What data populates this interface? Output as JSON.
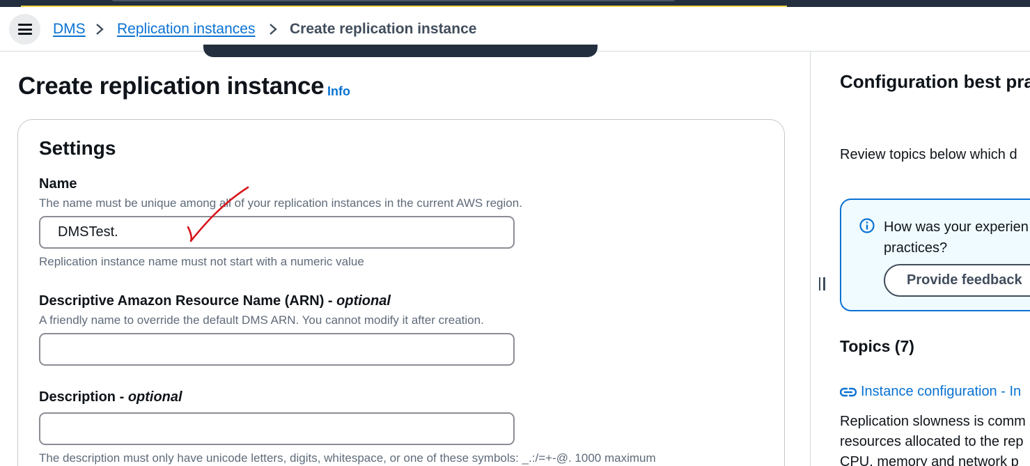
{
  "breadcrumb": {
    "items": [
      "DMS",
      "Replication instances",
      "Create replication instance"
    ]
  },
  "page": {
    "title": "Create replication instance",
    "info_label": "Info"
  },
  "settings": {
    "title": "Settings",
    "name": {
      "label": "Name",
      "description": "The name must be unique among all of your replication instances in the current AWS region.",
      "value": "DMSTest.",
      "constraint": "Replication instance name must not start with a numeric value"
    },
    "arn": {
      "label": "Descriptive Amazon Resource Name (ARN)",
      "optional_suffix": "optional",
      "description": "A friendly name to override the default DMS ARN. You cannot modify it after creation.",
      "value": ""
    },
    "description_field": {
      "label": "Description",
      "optional_suffix": "optional",
      "value": "",
      "constraint": "The description must only have unicode letters, digits, whitespace, or one of these symbols: _.:/=+-@. 1000 maximum"
    }
  },
  "side_panel": {
    "title": "Configuration best pra",
    "intro": "Review topics below which d",
    "feedback": {
      "question": "How was your experien\npractices?",
      "button_label": "Provide feedback"
    },
    "topics_title": "Topics (7)",
    "topic_link": "Instance configuration - In",
    "topic_text": "Replication slowness is comm\nresources allocated to the rep\nCPU, memory and network p"
  },
  "colors": {
    "link": "#0972d3",
    "annotation": "#d6161c",
    "info_box_bg": "#f0fbff",
    "nav_dark": "#232f3e"
  },
  "icons": [
    "menu-icon",
    "chevron-right-icon",
    "info-circle-icon",
    "external-link-icon",
    "drag-handle-icon",
    "checkmark-annotation"
  ]
}
